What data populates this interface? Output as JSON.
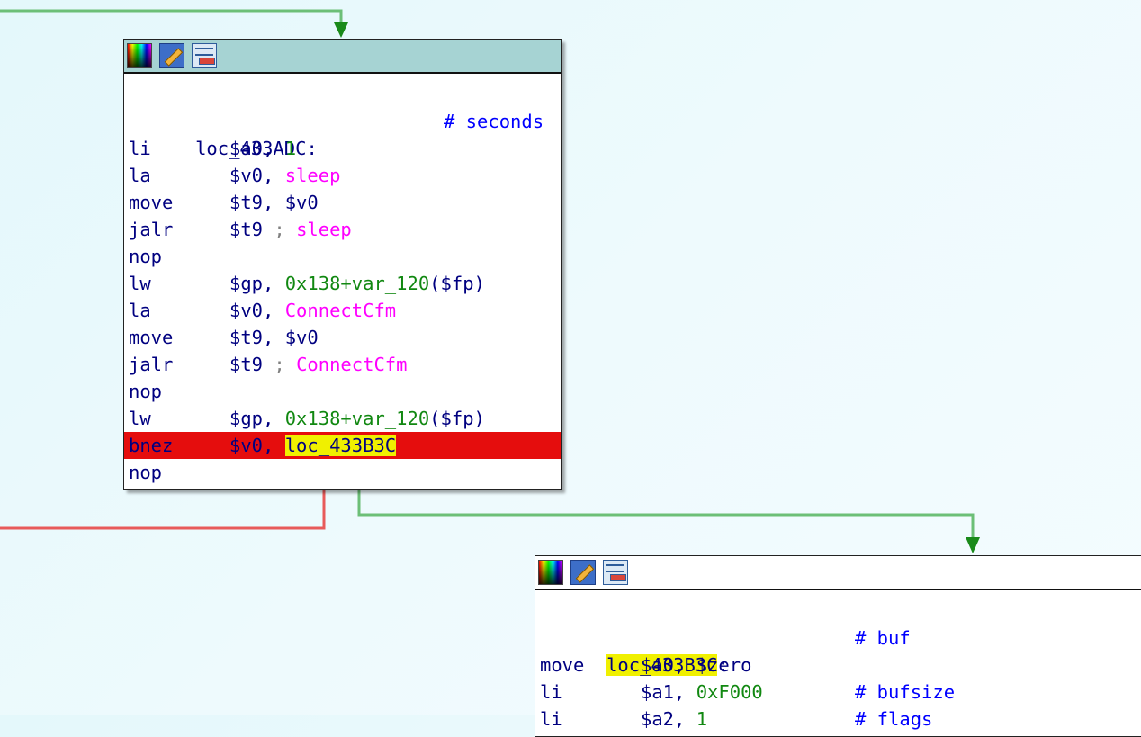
{
  "theme": {
    "background": "#e4f8fb",
    "edge_true": "#6cbf77",
    "edge_false": "#e85a5a",
    "arrow_color": "#1a8a1a",
    "highlight_line": "#e50d0d",
    "highlight_word": "#f0f000"
  },
  "toolbar_icons": [
    "color-palette-icon",
    "rename-edit-icon",
    "graph-overview-icon"
  ],
  "block1": {
    "label": "loc_433ADC:",
    "label_comment": "# seconds",
    "lines": [
      {
        "mnem": "li",
        "ops": "$a0, ",
        "arg": "1",
        "arg_type": "num"
      },
      {
        "mnem": "la",
        "ops": "$v0, ",
        "arg": "sleep",
        "arg_type": "name"
      },
      {
        "mnem": "move",
        "ops": "$t9, $v0"
      },
      {
        "mnem": "jalr",
        "ops": "$t9 ",
        "punct": "; ",
        "arg": "sleep",
        "arg_type": "name"
      },
      {
        "mnem": "nop"
      },
      {
        "mnem": "lw",
        "ops": "$gp, ",
        "arg": "0x138+var_120",
        "arg_type": "num",
        "tail": "($fp)"
      },
      {
        "mnem": "la",
        "ops": "$v0, ",
        "arg": "ConnectCfm",
        "arg_type": "name"
      },
      {
        "mnem": "move",
        "ops": "$t9, $v0"
      },
      {
        "mnem": "jalr",
        "ops": "$t9 ",
        "punct": "; ",
        "arg": "ConnectCfm",
        "arg_type": "name"
      },
      {
        "mnem": "nop"
      },
      {
        "mnem": "lw",
        "ops": "$gp, ",
        "arg": "0x138+var_120",
        "arg_type": "num",
        "tail": "($fp)"
      },
      {
        "mnem": "bnez",
        "ops": "$v0, ",
        "arg": "loc_433B3C",
        "arg_type": "yhl",
        "highlight": true
      },
      {
        "mnem": "nop"
      }
    ]
  },
  "block2": {
    "label": "loc_433B3C",
    "label_suffix": ":",
    "label_comment": "# buf",
    "lines": [
      {
        "mnem": "move",
        "ops": "$a0, $zero"
      },
      {
        "mnem": "li",
        "ops": "$a1, ",
        "arg": "0xF000",
        "arg_type": "num",
        "comment": "# bufsize"
      },
      {
        "mnem": "li",
        "ops": "$a2, ",
        "arg": "1",
        "arg_type": "num",
        "comment": "# flags"
      }
    ]
  }
}
